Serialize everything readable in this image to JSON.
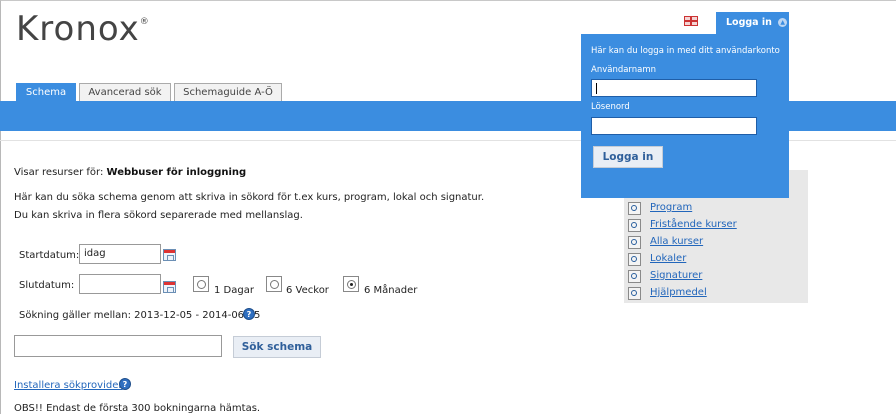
{
  "header": {
    "logo_text": "Kronox",
    "login_label": "Logga in"
  },
  "tabs": [
    {
      "label": "Schema",
      "active": true
    },
    {
      "label": "Avancerad sök",
      "active": false
    },
    {
      "label": "Schemaguide A-Ö",
      "active": false
    }
  ],
  "main": {
    "visar_prefix": "Visar resurser för: ",
    "visar_value": "Webbuser för inloggning",
    "info_line1": "Här kan du söka schema genom att skriva in sökord för t.ex kurs, program, lokal och signatur.",
    "info_line2": "Du kan skriva in flera sökord separerade med mellanslag.",
    "startdatum_label": "Startdatum:",
    "startdatum_value": "idag",
    "slutdatum_label": "Slutdatum:",
    "slutdatum_value": "",
    "radio_options": [
      {
        "label": "1 Dagar",
        "checked": false
      },
      {
        "label": "6 Veckor",
        "checked": false
      },
      {
        "label": "6 Månader",
        "checked": true
      }
    ],
    "range_text": "Sökning gäller mellan: 2013-12-05 - 2014-06-05",
    "search_value": "",
    "search_button": "Sök schema",
    "installera_link": "Installera sökprovider",
    "obs_text": "OBS!! Endast de första 300 bokningarna hämtas."
  },
  "side_links": [
    "Program",
    "Fristående kurser",
    "Alla kurser",
    "Lokaler",
    "Signaturer",
    "Hjälpmedel"
  ],
  "login_popup": {
    "intro": "Här kan du logga in med ditt användarkonto",
    "username_label": "Användarnamn",
    "username_value": "",
    "password_label": "Lösenord",
    "password_value": "",
    "submit_label": "Logga in"
  },
  "colors": {
    "accent": "#3b8de0",
    "link": "#2266bb",
    "panel": "#e8e8e8"
  }
}
